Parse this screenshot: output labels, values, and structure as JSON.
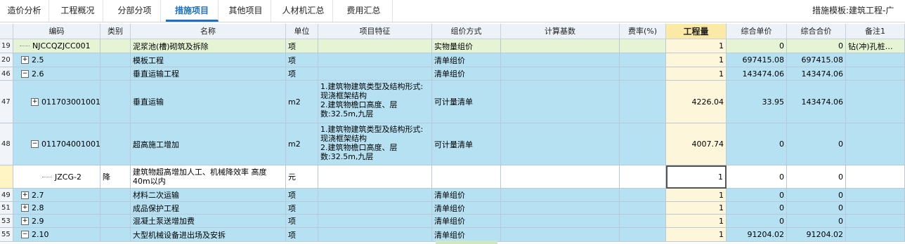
{
  "tabs": [
    {
      "label": "造价分析",
      "active": false
    },
    {
      "label": "工程概况",
      "active": false
    },
    {
      "label": "分部分项",
      "active": false
    },
    {
      "label": "措施项目",
      "active": true
    },
    {
      "label": "其他项目",
      "active": false
    },
    {
      "label": "人材机汇总",
      "active": false
    },
    {
      "label": "费用汇总",
      "active": false
    }
  ],
  "template": {
    "icon": "book-icon",
    "label": "措施模板:建筑工程-广"
  },
  "columns": [
    "编码",
    "类别",
    "名称",
    "单位",
    "项目特征",
    "组价方式",
    "计算基数",
    "费率(%)",
    "工程量",
    "综合单价",
    "综合合价",
    "备注1"
  ],
  "rows": [
    {
      "num": "19",
      "code": "NJCCQZJCC001",
      "type": "",
      "name": "泥浆池(槽)砌筑及拆除",
      "unit": "项",
      "feature": "",
      "method": "实物量组价",
      "base": "",
      "rate": "",
      "qty": "1",
      "price": "0",
      "total": "0",
      "note": "钻(冲)孔桩…",
      "expander": "",
      "tree": true
    },
    {
      "num": "20",
      "code": "2.5",
      "type": "",
      "name": "模板工程",
      "unit": "项",
      "feature": "",
      "method": "清单组价",
      "base": "",
      "rate": "",
      "qty": "1",
      "price": "697415.08",
      "total": "697415.08",
      "note": "",
      "expander": "+",
      "tree": false
    },
    {
      "num": "46",
      "code": "2.6",
      "type": "",
      "name": "垂直运输工程",
      "unit": "项",
      "feature": "",
      "method": "清单组价",
      "base": "",
      "rate": "",
      "qty": "1",
      "price": "143474.06",
      "total": "143474.06",
      "note": "",
      "expander": "−",
      "tree": false
    },
    {
      "num": "47",
      "code": "011703001001",
      "type": "",
      "name": "垂直运输",
      "unit": "m2",
      "feature": "1.建筑物建筑类型及结构形式:现浇框架结构\n2.建筑物檐口高度、层数:32.5m,九层",
      "method": "可计量清单",
      "base": "",
      "rate": "",
      "qty": "4226.04",
      "price": "33.95",
      "total": "143474.06",
      "note": "",
      "expander": "+",
      "tree": false
    },
    {
      "num": "48",
      "code": "011704001001",
      "type": "",
      "name": "超高施工增加",
      "unit": "m2",
      "feature": "1.建筑物建筑类型及结构形式:现浇框架结构\n2.建筑物檐口高度、层数:32.5m,九层",
      "method": "可计量清单",
      "base": "",
      "rate": "",
      "qty": "4007.74",
      "price": "0",
      "total": "0",
      "note": "",
      "expander": "−",
      "tree": false
    },
    {
      "num": "",
      "code": "JZCG-2",
      "type": "降",
      "name": "建筑物超高增加人工、机械降效率 高度40m以内",
      "unit": "元",
      "feature": "",
      "method": "",
      "base": "",
      "rate": "",
      "qty": "1",
      "price": "0",
      "total": "0",
      "note": "",
      "expander": "",
      "tree": true
    },
    {
      "num": "49",
      "code": "2.7",
      "type": "",
      "name": "材料二次运输",
      "unit": "项",
      "feature": "",
      "method": "清单组价",
      "base": "",
      "rate": "",
      "qty": "1",
      "price": "0",
      "total": "0",
      "note": "",
      "expander": "+",
      "tree": false
    },
    {
      "num": "51",
      "code": "2.8",
      "type": "",
      "name": "成品保护工程",
      "unit": "项",
      "feature": "",
      "method": "清单组价",
      "base": "",
      "rate": "",
      "qty": "1",
      "price": "0",
      "total": "0",
      "note": "",
      "expander": "+",
      "tree": false
    },
    {
      "num": "53",
      "code": "2.9",
      "type": "",
      "name": "混凝土泵送增加费",
      "unit": "项",
      "feature": "",
      "method": "清单组价",
      "base": "",
      "rate": "",
      "qty": "1",
      "price": "0",
      "total": "0",
      "note": "",
      "expander": "+",
      "tree": false
    },
    {
      "num": "55",
      "code": "2.10",
      "type": "",
      "name": "大型机械设备进出场及安拆",
      "unit": "项",
      "feature": "",
      "method": "清单组价",
      "base": "",
      "rate": "",
      "qty": "1",
      "price": "91204.02",
      "total": "91204.02",
      "note": "",
      "expander": "−",
      "tree": false
    }
  ]
}
